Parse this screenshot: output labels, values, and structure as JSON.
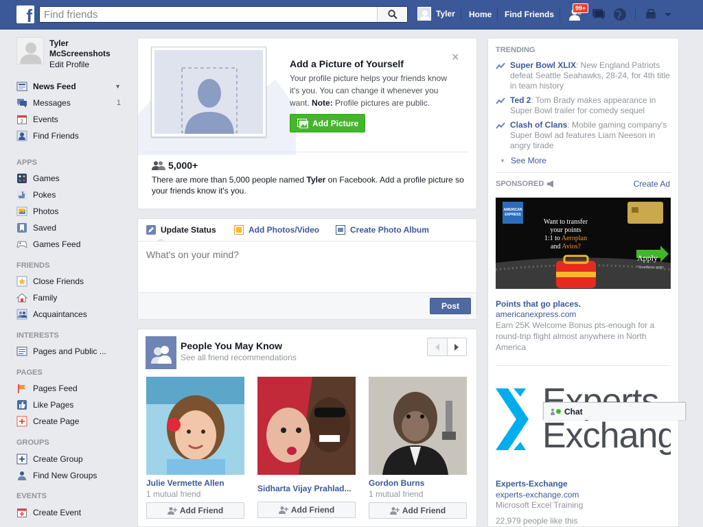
{
  "topbar": {
    "logo": "f",
    "search_placeholder": "Find friends",
    "user_name": "Tyler",
    "home_label": "Home",
    "find_friends_label": "Find Friends",
    "notifications_badge": "99+"
  },
  "sidebar": {
    "profile_name": "Tyler McScreenshots",
    "edit_profile": "Edit Profile",
    "favorites": [
      {
        "label": "News Feed",
        "count": ""
      },
      {
        "label": "Messages",
        "count": "1"
      },
      {
        "label": "Events",
        "count": ""
      },
      {
        "label": "Find Friends",
        "count": ""
      }
    ],
    "apps_title": "APPS",
    "apps": [
      "Games",
      "Pokes",
      "Photos",
      "Saved",
      "Games Feed"
    ],
    "friends_title": "FRIENDS",
    "friends": [
      "Close Friends",
      "Family",
      "Acquaintances"
    ],
    "interests_title": "INTERESTS",
    "interests": [
      "Pages and Public ..."
    ],
    "pages_title": "PAGES",
    "pages": [
      "Pages Feed",
      "Like Pages",
      "Create Page"
    ],
    "groups_title": "GROUPS",
    "groups": [
      "Create Group",
      "Find New Groups"
    ],
    "events_title": "EVENTS",
    "events": [
      "Create Event"
    ]
  },
  "add_picture": {
    "title": "Add a Picture of Yourself",
    "body": "Your profile picture helps your friends know it's you. You can change it whenever you want.",
    "note_label": "Note:",
    "note_text": "Profile pictures are public.",
    "button": "Add Picture",
    "close": "×",
    "count": "5,000+",
    "count_text_pre": "There are more than 5,000 people named",
    "count_name": "Tyler",
    "count_text_post": "on Facebook. Add a profile picture so your friends know it's you."
  },
  "composer": {
    "tab_status": "Update Status",
    "tab_photos": "Add Photos/Video",
    "tab_album": "Create Photo Album",
    "placeholder": "What's on your mind?",
    "post": "Post"
  },
  "pymk": {
    "title": "People You May Know",
    "subtitle": "See all friend recommendations",
    "people": [
      {
        "name": "Julie Vermette Allen",
        "mutual": "1 mutual friend",
        "button": "Add Friend"
      },
      {
        "name": "Sidharta Vijay Prahlad...",
        "mutual": "",
        "button": "Add Friend"
      },
      {
        "name": "Gordon Burns",
        "mutual": "1 mutual friend",
        "button": "Add Friend"
      }
    ]
  },
  "trending": {
    "title": "TRENDING",
    "items": [
      {
        "topic": "Super Bowl XLIX",
        "text": ": New England Patriots defeat Seattle Seahawks, 28-24, for 4th title in team history"
      },
      {
        "topic": "Ted 2",
        "text": ": Tom Brady makes appearance in Super Bowl trailer for comedy sequel"
      },
      {
        "topic": "Clash of Clans",
        "text": ": Mobile gaming company's Super Bowl ad features Liam Neeson in angry tirade"
      }
    ],
    "see_more": "See More"
  },
  "sponsored": {
    "title": "SPONSORED",
    "create_ad": "Create Ad",
    "ads": [
      {
        "headline": "Points that go places.",
        "domain": "americanexpress.com",
        "body": "Earn 25K Welcome Bonus pts-enough for a round-trip flight almost anywhere in North America",
        "image_text_1": "Want to transfer",
        "image_text_2": "your points",
        "image_text_3": "1:1 to",
        "image_text_4": "Aeroplan",
        "image_text_5": "and",
        "image_text_6": "Avios?",
        "apply": "Apply",
        "conditions": "*Conditions apply",
        "brand_box": "AMERICAN EXPRESS"
      },
      {
        "headline": "Experts-Exchange",
        "domain": "experts-exchange.com",
        "body": "Microsoft Excel Training",
        "likes": "22,979 people like this",
        "logo_line1": "Experts",
        "logo_line2": "Exchang"
      }
    ]
  },
  "chat": {
    "label": "Chat"
  },
  "colors": {
    "brand": "#3b5998",
    "green": "#42b72a",
    "badge": "#f03d25"
  }
}
